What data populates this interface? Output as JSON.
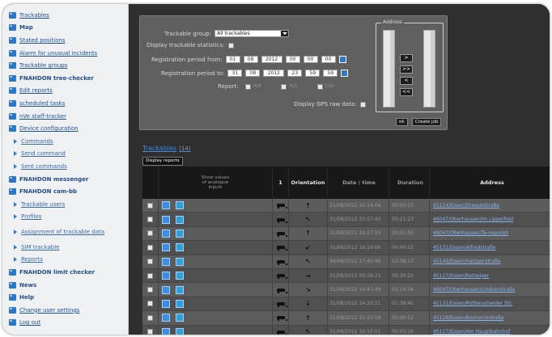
{
  "sidebar": {
    "items": [
      {
        "label": "Trackables",
        "type": "link"
      },
      {
        "label": "Map",
        "type": "plain"
      },
      {
        "label": "Stated positions",
        "type": "link"
      },
      {
        "label": "Alarm for unusual incidents",
        "type": "link"
      },
      {
        "label": "Trackable groups",
        "type": "link"
      },
      {
        "label": "FNAHDON tree-checker",
        "type": "plain"
      },
      {
        "label": "Edit reports",
        "type": "link"
      },
      {
        "label": "scheduled tasks",
        "type": "link"
      },
      {
        "label": "nVe staff-tracker",
        "type": "link"
      },
      {
        "label": "Device configuration",
        "type": "link"
      },
      {
        "label": "Commands",
        "type": "sub"
      },
      {
        "label": "Send command",
        "type": "sub"
      },
      {
        "label": "Sent commands",
        "type": "sub"
      },
      {
        "label": "FNAHDON messenger",
        "type": "plain"
      },
      {
        "label": "FNAHDON cam-bb",
        "type": "plain"
      },
      {
        "label": "Trackable users",
        "type": "sub"
      },
      {
        "label": "Profiles",
        "type": "sub"
      },
      {
        "label": "Assignment of trackable data",
        "type": "sub-tall"
      },
      {
        "label": "SIM trackable",
        "type": "sub"
      },
      {
        "label": "Reports",
        "type": "sub"
      },
      {
        "label": "FNAHDON limit checker",
        "type": "plain"
      },
      {
        "label": "News",
        "type": "plain"
      },
      {
        "label": "Help",
        "type": "plain"
      },
      {
        "label": "Change user settings",
        "type": "link"
      },
      {
        "label": "Log out",
        "type": "link"
      }
    ]
  },
  "filter": {
    "group_label": "Trackable group:",
    "group_value": "All trackables",
    "stats_label": "Display trackable statistics:",
    "from_label": "Registration period from:",
    "from": [
      "01",
      "08",
      "2012",
      "00",
      "00",
      "00"
    ],
    "to_label": "Registration period to:",
    "to": [
      "31",
      "08",
      "2012",
      "23",
      "59",
      "59"
    ],
    "report_label": "Report:",
    "report_options": [
      "PDF",
      "XLS",
      "CSV"
    ],
    "raw_label": "Display GPS raw data:",
    "address_legend": "Address",
    "addr_buttons": [
      ">",
      ">>",
      "<",
      "<<"
    ],
    "ok_label": "ok",
    "create_job_label": "Create job"
  },
  "trackables": {
    "title": "Trackables",
    "count": "(14)",
    "display_reports_label": "Display reports",
    "columns": {
      "show_values": "Show values of analogue inputs",
      "v": "1",
      "orientation": "Orientation",
      "datetime": "Date / time",
      "duration": "Duration",
      "address": "Address"
    },
    "rows": [
      {
        "orientation": "↑",
        "datetime": "21/08/2012 16:14:06",
        "duration": "00:00:15",
        "address": "45124/Essen/Drosselstraße"
      },
      {
        "orientation": "↖",
        "datetime": "31/08/2012 15:57:43",
        "duration": "00:21:23",
        "address": "46047/Oberhausen/Im Lipperfeld"
      },
      {
        "orientation": "↑",
        "datetime": "31/08/2012 16:17:10",
        "duration": "00:01:50",
        "address": "46047/Oberhausen/Te-nopunkt"
      },
      {
        "orientation": "↙",
        "datetime": "31/08/2012 16:14:06",
        "duration": "00:00:15",
        "address": "45131/Essen/Alfredstraße"
      },
      {
        "orientation": "↖",
        "datetime": "30/08/2012 17:40:40",
        "duration": "22:38:17",
        "address": "45149/Essen/Hatzperstraße"
      },
      {
        "orientation": "→",
        "datetime": "31/08/2012 09:58:23",
        "duration": "00:30:22",
        "address": "45127/Essen/Kettwiger"
      },
      {
        "orientation": "↘",
        "datetime": "31/08/2012 14:47:49",
        "duration": "01:16:34",
        "address": "46047/Oberhausen/Lindnerstraße"
      },
      {
        "orientation": "↓",
        "datetime": "31/08/2012 14:20:21",
        "duration": "01:38:40",
        "address": "45131/Essen/Rüttenscheider Str."
      },
      {
        "orientation": "↑",
        "datetime": "31/08/2012 15:23:58",
        "duration": "00:00:12",
        "address": "45128/Essen/Bismarckstraße"
      },
      {
        "orientation": "↖",
        "datetime": "31/08/2012 16:15:01",
        "duration": "00:03:16",
        "address": "45127/Essen/Am Hauptbahnhof"
      }
    ]
  }
}
